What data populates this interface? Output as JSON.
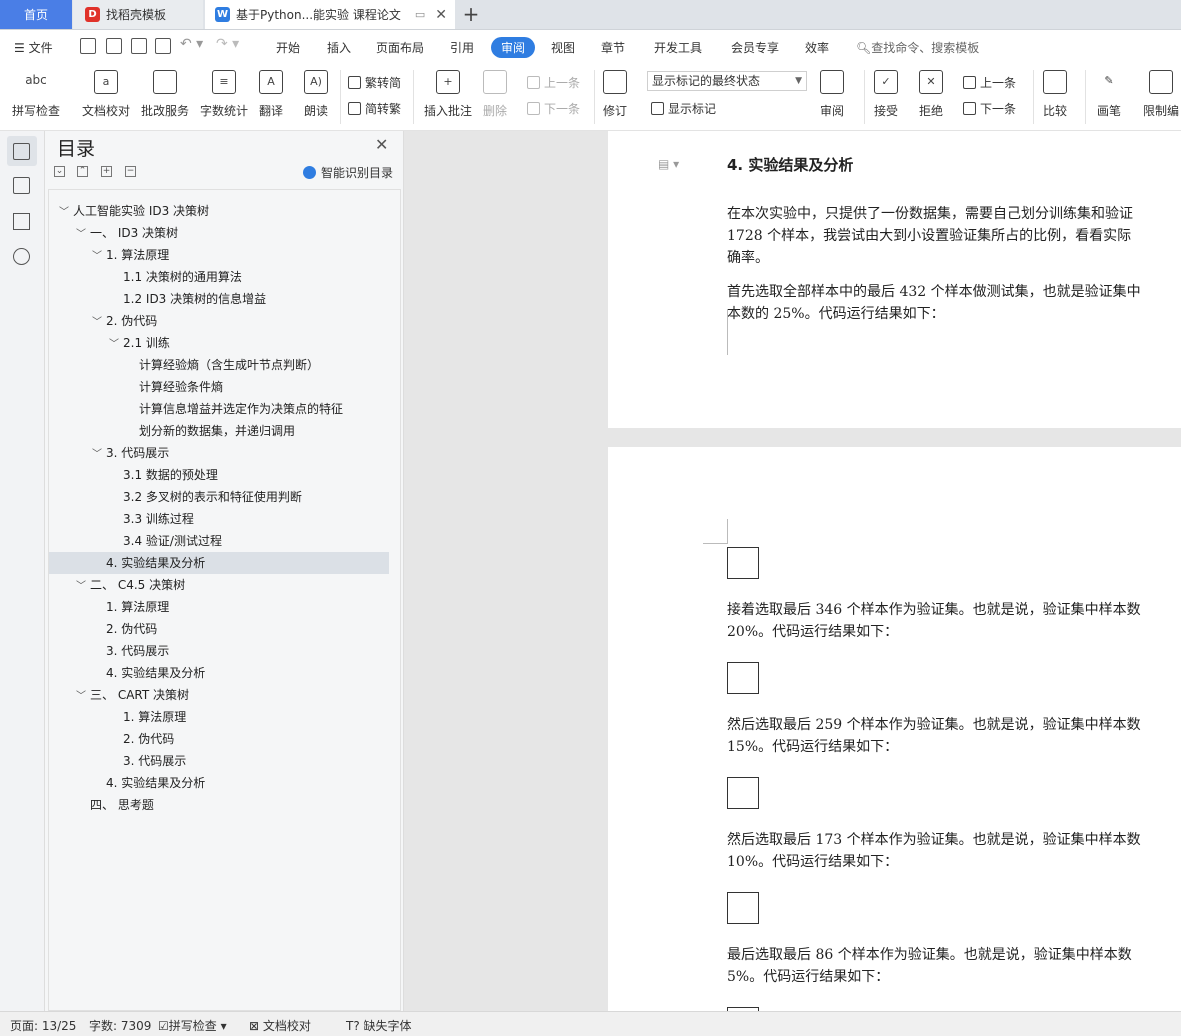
{
  "tabs": {
    "home": "首页",
    "daoke": "找稻壳模板",
    "doc": "基于Python...能实验 课程论文"
  },
  "menubar": {
    "file": "文件",
    "items": [
      "开始",
      "插入",
      "页面布局",
      "引用",
      "审阅",
      "视图",
      "章节",
      "开发工具",
      "会员专享",
      "效率"
    ],
    "active": "审阅",
    "search_placeholder": "查找命令、搜索模板"
  },
  "ribbon": {
    "spellcheck": "拼写检查",
    "doc_proof": "文档校对",
    "review_service": "批改服务",
    "word_count": "字数统计",
    "translate": "翻译",
    "read_aloud": "朗读",
    "trad_to_simp": "繁转简",
    "simp_to_trad": "简转繁",
    "insert_comment": "插入批注",
    "delete": "删除",
    "prev_comment": "上一条",
    "next_comment": "下一条",
    "markup_state": "显示标记的最终状态",
    "track_changes": "修订",
    "show_markup": "显示标记",
    "review_pane": "审阅",
    "accept": "接受",
    "reject": "拒绝",
    "prev_change": "上一条",
    "next_change": "下一条",
    "compare": "比较",
    "pen": "画笔",
    "restrict_edit": "限制编"
  },
  "toc": {
    "title": "目录",
    "smart": "智能识别目录",
    "items": [
      {
        "text": "人工智能实验 ID3 决策树",
        "level": 0,
        "chev": true
      },
      {
        "text": "一、   ID3 决策树",
        "level": 1,
        "chev": true
      },
      {
        "text": "1. 算法原理",
        "level": 2,
        "chev": true
      },
      {
        "text": "1.1  决策树的通用算法",
        "level": 3,
        "chev": false
      },
      {
        "text": "1.2 ID3 决策树的信息增益",
        "level": 3,
        "chev": false
      },
      {
        "text": "2. 伪代码",
        "level": 2,
        "chev": true
      },
      {
        "text": "2.1  训练",
        "level": 3,
        "chev": true
      },
      {
        "text": "计算经验熵（含生成叶节点判断）",
        "level": 4,
        "chev": false
      },
      {
        "text": "计算经验条件熵",
        "level": 4,
        "chev": false
      },
      {
        "text": "计算信息增益并选定作为决策点的特征",
        "level": 4,
        "chev": false
      },
      {
        "text": "划分新的数据集，并递归调用",
        "level": 4,
        "chev": false
      },
      {
        "text": "3. 代码展示",
        "level": 2,
        "chev": true
      },
      {
        "text": "3.1  数据的预处理",
        "level": 3,
        "chev": false
      },
      {
        "text": "3.2  多叉树的表示和特征使用判断",
        "level": 3,
        "chev": false
      },
      {
        "text": "3.3  训练过程",
        "level": 3,
        "chev": false
      },
      {
        "text": "3.4  验证/测试过程",
        "level": 3,
        "chev": false
      },
      {
        "text": "4. 实验结果及分析",
        "level": 2,
        "chev": false,
        "active": true
      },
      {
        "text": "二、   C4.5 决策树",
        "level": 1,
        "chev": true
      },
      {
        "text": "1. 算法原理",
        "level": 2,
        "chev": false
      },
      {
        "text": "2. 伪代码",
        "level": 2,
        "chev": false
      },
      {
        "text": "3. 代码展示",
        "level": 2,
        "chev": false
      },
      {
        "text": "4. 实验结果及分析",
        "level": 2,
        "chev": false
      },
      {
        "text": "三、   CART 决策树",
        "level": 1,
        "chev": true
      },
      {
        "text": "1. 算法原理",
        "level": 3,
        "chev": false
      },
      {
        "text": "2. 伪代码",
        "level": 3,
        "chev": false
      },
      {
        "text": "3. 代码展示",
        "level": 3,
        "chev": false
      },
      {
        "text": "4. 实验结果及分析",
        "level": 2,
        "chev": false
      },
      {
        "text": "四、   思考题",
        "level": 1,
        "chev": false
      }
    ]
  },
  "document": {
    "heading": "4.  实验结果及分析",
    "p1": [
      "在本次实验中，只提供了一份数据集，需要自己划分训练集和验证",
      "1728 个样本，我尝试由大到小设置验证集所占的比例，看看实际",
      "确率。"
    ],
    "p2": [
      "首先选取全部样本中的最后 432 个样本做测试集，也就是验证集中",
      "本数的 25%。代码运行结果如下："
    ],
    "p3": [
      "接着选取最后 346 个样本作为验证集。也就是说，验证集中样本数",
      "20%。代码运行结果如下："
    ],
    "p4": [
      "然后选取最后 259 个样本作为验证集。也就是说，验证集中样本数",
      "15%。代码运行结果如下："
    ],
    "p5": [
      "然后选取最后 173 个样本作为验证集。也就是说，验证集中样本数",
      "10%。代码运行结果如下："
    ],
    "p6": [
      "最后选取最后 86 个样本作为验证集。也就是说，验证集中样本数",
      "5%。代码运行结果如下："
    ]
  },
  "status": {
    "page": "页面: 13/25",
    "words": "字数: 7309",
    "spellcheck": "拼写检查",
    "proof": "文档校对",
    "missing_font": "缺失字体"
  },
  "colors": {
    "accent": "#2f7de1",
    "home_tab": "#4a7ee6"
  }
}
